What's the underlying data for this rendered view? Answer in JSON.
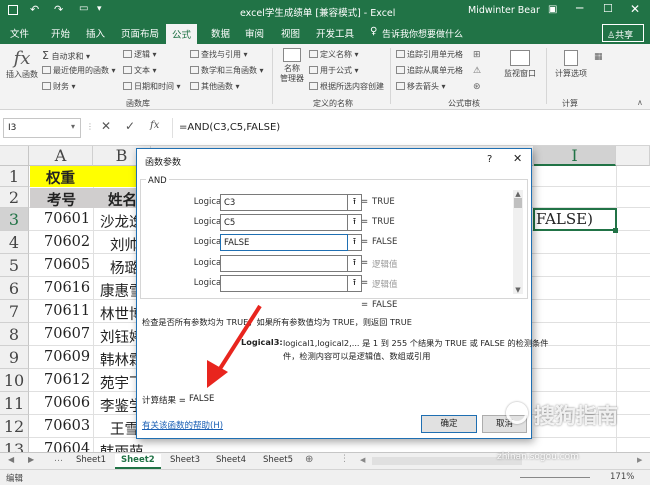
{
  "titlebar": {
    "file_title": "excel学生成绩单 [兼容模式] - Excel",
    "user": "Midwinter Bear"
  },
  "ribbon_tabs": [
    "文件",
    "开始",
    "插入",
    "页面布局",
    "公式",
    "数据",
    "审阅",
    "视图",
    "开发工具"
  ],
  "ribbon_search": "告诉我你想要做什么",
  "share_label": "共享",
  "ribbon": {
    "insert_function": "插入函数",
    "autosum": "自动求和",
    "recent": "最近使用的函数",
    "financial": "财务",
    "logical": "逻辑",
    "text": "文本",
    "datetime": "日期和时间",
    "lookup": "查找与引用",
    "math": "数学和三角函数",
    "other": "其他函数",
    "group_library": "函数库",
    "name_manager": "名称\n管理器",
    "define_name": "定义名称",
    "use_in_formula": "用于公式",
    "create_from_sel": "根据所选内容创建",
    "group_names": "定义的名称",
    "trace_prec": "追踪引用单元格",
    "trace_dep": "追踪从属单元格",
    "remove_arrows": "移去箭头",
    "group_audit": "公式审核",
    "watch": "监视窗口",
    "calc_options": "计算选项",
    "group_calc": "计算"
  },
  "formula_bar": {
    "namebox": "I3",
    "formula": "=AND(C3,C5,FALSE)"
  },
  "sheet": {
    "columns": [
      "A",
      "B",
      "I"
    ],
    "rows": [
      "1",
      "2",
      "3",
      "4",
      "5",
      "6",
      "7",
      "8",
      "9",
      "10",
      "11",
      "12",
      "13"
    ],
    "r1_a": "权重",
    "r2_a": "考号",
    "r2_b": "姓名",
    "ids": [
      "70601",
      "70602",
      "70605",
      "70616",
      "70611",
      "70607",
      "70609",
      "70612",
      "70606",
      "70603",
      "70604"
    ],
    "names": [
      "沙龙逸",
      "刘帅",
      "杨璐",
      "康惠雪",
      "林世博",
      "刘钰婷",
      "韩林霖",
      "苑宇飞",
      "李鉴学",
      "王雪",
      "韩雨萌"
    ],
    "cell_i3": "FALSE)"
  },
  "dialog": {
    "title": "函数参数",
    "help_q": "?",
    "function_name": "AND",
    "args": [
      {
        "label": "Logical1",
        "value": "C3",
        "result": "TRUE"
      },
      {
        "label": "Logical2",
        "value": "C5",
        "result": "TRUE"
      },
      {
        "label": "Logical3",
        "value": "FALSE",
        "result": "FALSE"
      },
      {
        "label": "Logical4",
        "value": "",
        "result": "逻辑值"
      },
      {
        "label": "Logical5",
        "value": "",
        "result": "逻辑值"
      }
    ],
    "eq": "=",
    "overall": "FALSE",
    "description": "检查是否所有参数均为 TRUE，如果所有参数值均为 TRUE，则返回 TRUE",
    "arg_name": "Logical3:",
    "arg_desc_1": "logical1,logical2,... 是 1 到 255 个结果为 TRUE 或 FALSE 的检测条件",
    "arg_desc_2": "件，检测内容可以是逻辑值、数组或引用",
    "calc_result_label": "计算结果 =",
    "calc_result": "FALSE",
    "help_link": "有关该函数的帮助(H)",
    "ok": "确定",
    "cancel": "取消"
  },
  "sheet_tabs": [
    "Sheet1",
    "Sheet2",
    "Sheet3",
    "Sheet4",
    "Sheet5"
  ],
  "status": {
    "mode": "编辑",
    "zoom": "171%"
  },
  "watermark": "搜狗指南",
  "watermark_url": "zhinan.sogou.com",
  "colors": {
    "excel_green": "#217346",
    "dialog_border": "#1f6fb2",
    "arrow_red": "#e8251e",
    "weight_yellow": "#ffff00"
  }
}
